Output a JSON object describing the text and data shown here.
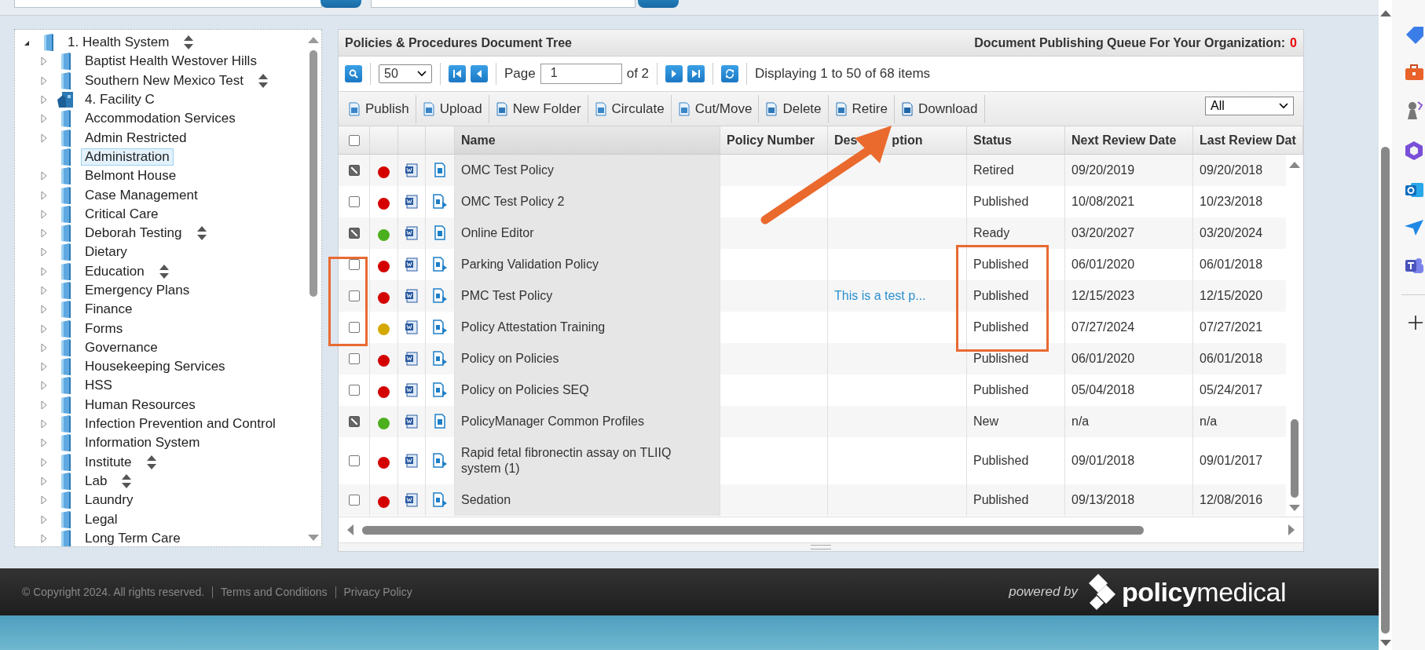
{
  "tree": [
    {
      "label": "1. Health System",
      "kind": "folder",
      "expanded": true,
      "sortable": true,
      "selected": false,
      "children": [
        {
          "label": "Baptist Health Westover Hills",
          "kind": "folder",
          "expandable": true,
          "sortable": false,
          "selected": false
        },
        {
          "label": "Southern New Mexico Test",
          "kind": "folder",
          "expandable": true,
          "sortable": true,
          "selected": false
        },
        {
          "label": "4. Facility C",
          "kind": "facility",
          "expandable": true,
          "sortable": false,
          "selected": false
        },
        {
          "label": "Accommodation Services",
          "kind": "folder",
          "expandable": true,
          "sortable": false,
          "selected": false
        },
        {
          "label": "Admin Restricted",
          "kind": "folder",
          "expandable": true,
          "sortable": false,
          "selected": false
        },
        {
          "label": "Administration",
          "kind": "folder",
          "expandable": false,
          "sortable": false,
          "selected": true
        },
        {
          "label": "Belmont House",
          "kind": "folder",
          "expandable": true,
          "sortable": false,
          "selected": false
        },
        {
          "label": "Case Management",
          "kind": "folder",
          "expandable": true,
          "sortable": false,
          "selected": false
        },
        {
          "label": "Critical Care",
          "kind": "folder",
          "expandable": true,
          "sortable": false,
          "selected": false
        },
        {
          "label": "Deborah Testing",
          "kind": "folder",
          "expandable": true,
          "sortable": true,
          "selected": false
        },
        {
          "label": "Dietary",
          "kind": "folder",
          "expandable": true,
          "sortable": false,
          "selected": false
        },
        {
          "label": "Education",
          "kind": "folder",
          "expandable": true,
          "sortable": true,
          "selected": false
        },
        {
          "label": "Emergency Plans",
          "kind": "folder",
          "expandable": true,
          "sortable": false,
          "selected": false
        },
        {
          "label": "Finance",
          "kind": "folder",
          "expandable": true,
          "sortable": false,
          "selected": false
        },
        {
          "label": "Forms",
          "kind": "folder",
          "expandable": true,
          "sortable": false,
          "selected": false
        },
        {
          "label": "Governance",
          "kind": "folder",
          "expandable": true,
          "sortable": false,
          "selected": false
        },
        {
          "label": "Housekeeping Services",
          "kind": "folder",
          "expandable": true,
          "sortable": false,
          "selected": false
        },
        {
          "label": "HSS",
          "kind": "folder",
          "expandable": true,
          "sortable": false,
          "selected": false
        },
        {
          "label": "Human Resources",
          "kind": "folder",
          "expandable": true,
          "sortable": false,
          "selected": false
        },
        {
          "label": "Infection Prevention and Control",
          "kind": "folder",
          "expandable": true,
          "sortable": false,
          "selected": false
        },
        {
          "label": "Information System",
          "kind": "folder",
          "expandable": true,
          "sortable": false,
          "selected": false
        },
        {
          "label": "Institute",
          "kind": "folder",
          "expandable": true,
          "sortable": true,
          "selected": false
        },
        {
          "label": "Lab",
          "kind": "folder",
          "expandable": true,
          "sortable": true,
          "selected": false
        },
        {
          "label": "Laundry",
          "kind": "folder",
          "expandable": true,
          "sortable": false,
          "selected": false
        },
        {
          "label": "Legal",
          "kind": "folder",
          "expandable": true,
          "sortable": false,
          "selected": false
        },
        {
          "label": "Long Term Care",
          "kind": "folder",
          "expandable": true,
          "sortable": false,
          "selected": false
        }
      ]
    }
  ],
  "panel": {
    "title": "Policies & Procedures Document Tree",
    "queue_label": "Document Publishing Queue For Your Organization:",
    "queue_count": "0"
  },
  "pager": {
    "page_size": "50",
    "page_label": "Page",
    "page": "1",
    "page_total": "of 2",
    "summary": "Displaying 1 to 50 of 68 items"
  },
  "actions": [
    {
      "label": "Publish",
      "kind": "publish"
    },
    {
      "label": "Upload",
      "kind": "upload"
    },
    {
      "label": "New Folder",
      "kind": "folder"
    },
    {
      "label": "Circulate",
      "kind": "circulate"
    },
    {
      "label": "Cut/Move",
      "kind": "move"
    },
    {
      "label": "Delete",
      "kind": "delete"
    },
    {
      "label": "Retire",
      "kind": "retire"
    },
    {
      "label": "Download",
      "kind": "download"
    }
  ],
  "filter": {
    "value": "All"
  },
  "table": {
    "select_all": {
      "checked": false
    },
    "columns": [
      {
        "label": "Name"
      },
      {
        "label": "Policy Number"
      },
      {
        "label": "Des",
        "label_after_arrow": "ption"
      },
      {
        "label": "Status"
      },
      {
        "label": "Next Review Date"
      },
      {
        "label": "Last Review Dat"
      }
    ],
    "rows": [
      {
        "checked": true,
        "color": "#d40000",
        "kind": "plain",
        "name": "OMC Test Policy",
        "status": "Retired",
        "next_review": "09/20/2019",
        "last_review": "09/20/2018"
      },
      {
        "checked": false,
        "color": "#d40000",
        "kind": "linked",
        "name": "OMC Test Policy 2",
        "status": "Published",
        "next_review": "10/08/2021",
        "last_review": "10/23/2018"
      },
      {
        "checked": true,
        "color": "#4caf1e",
        "kind": "plain",
        "name": "Online Editor",
        "status": "Ready",
        "next_review": "03/20/2027",
        "last_review": "03/20/2024"
      },
      {
        "checked": false,
        "color": "#d40000",
        "kind": "linked",
        "name": "Parking Validation Policy",
        "status": "Published",
        "next_review": "06/01/2020",
        "last_review": "06/01/2018"
      },
      {
        "checked": false,
        "color": "#d40000",
        "kind": "linked",
        "name": "PMC Test Policy",
        "description": "This is a test p...",
        "status": "Published",
        "next_review": "12/15/2023",
        "last_review": "12/15/2020"
      },
      {
        "checked": false,
        "color": "#d4a800",
        "kind": "linked",
        "name": "Policy Attestation Training",
        "status": "Published",
        "next_review": "07/27/2024",
        "last_review": "07/27/2021"
      },
      {
        "checked": false,
        "color": "#d40000",
        "kind": "linked",
        "name": "Policy on Policies",
        "status": "Published",
        "next_review": "06/01/2020",
        "last_review": "06/01/2018"
      },
      {
        "checked": false,
        "color": "#d40000",
        "kind": "linked",
        "name": "Policy on Policies SEQ",
        "status": "Published",
        "next_review": "05/04/2018",
        "last_review": "05/24/2017"
      },
      {
        "checked": true,
        "color": "#4caf1e",
        "kind": "plain",
        "name": "PolicyManager Common Profiles",
        "status": "New",
        "next_review": "n/a",
        "last_review": "n/a"
      },
      {
        "checked": false,
        "color": "#d40000",
        "kind": "linked",
        "name": "Rapid fetal fibronectin assay on TLIIQ system (1)",
        "status": "Published",
        "next_review": "09/01/2018",
        "last_review": "09/01/2017"
      },
      {
        "checked": false,
        "color": "#d40000",
        "kind": "linked",
        "name": "Sedation",
        "status": "Published",
        "next_review": "09/13/2018",
        "last_review": "12/08/2016"
      }
    ]
  },
  "footer": {
    "copyright": "© Copyright 2024. All rights reserved.",
    "links": [
      "Terms and Conditions",
      "Privacy Policy"
    ],
    "powered_by": "powered by",
    "brand": "**policy**medical"
  }
}
